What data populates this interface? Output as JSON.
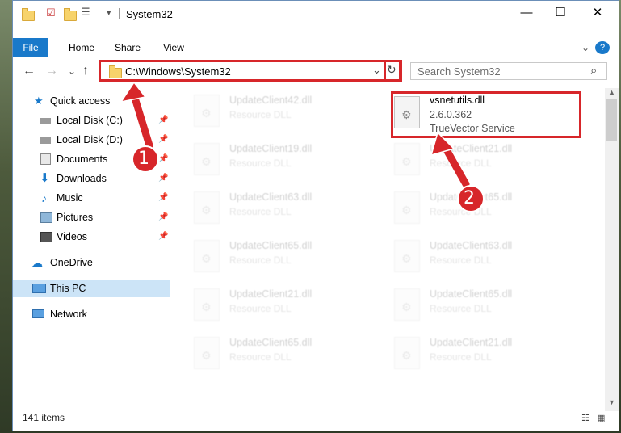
{
  "window": {
    "title": "System32",
    "minimize": "—",
    "maximize": "☐",
    "close": "✕"
  },
  "ribbon": {
    "tabs": [
      "File",
      "Home",
      "Share",
      "View"
    ],
    "expand_icon": "⌄",
    "help_icon": "?"
  },
  "navigation": {
    "back": "←",
    "forward": "→",
    "recent": "⌄",
    "up": "↑"
  },
  "address": {
    "path": "C:\\Windows\\System32",
    "dropdown": "⌄",
    "refresh": "↻"
  },
  "search": {
    "placeholder": "Search System32",
    "icon": "⌕"
  },
  "sidebar": {
    "items": [
      {
        "label": "Quick access",
        "icon": "star-icon"
      },
      {
        "label": "Local Disk (C:)",
        "icon": "drive-icon",
        "pinned": true
      },
      {
        "label": "Local Disk (D:)",
        "icon": "drive-icon",
        "pinned": true
      },
      {
        "label": "Documents",
        "icon": "documents-icon",
        "pinned": true
      },
      {
        "label": "Downloads",
        "icon": "download-icon",
        "pinned": true
      },
      {
        "label": "Music",
        "icon": "music-icon",
        "pinned": true
      },
      {
        "label": "Pictures",
        "icon": "pictures-icon",
        "pinned": true
      },
      {
        "label": "Videos",
        "icon": "videos-icon",
        "pinned": true
      },
      {
        "label": "OneDrive",
        "icon": "cloud-icon"
      },
      {
        "label": "This PC",
        "icon": "computer-icon",
        "selected": true
      },
      {
        "label": "Network",
        "icon": "network-icon"
      }
    ],
    "pin_glyph": "📌"
  },
  "files": {
    "highlighted": {
      "name": "vsnetutils.dll",
      "version": "2.6.0.362",
      "company": "TrueVector Service"
    },
    "faded": [
      {
        "name": "UpdateClient42.dll",
        "desc": "Resource DLL"
      },
      {
        "name": "UpdateClient19.dll",
        "desc": "Resource DLL"
      },
      {
        "name": "UpdateClient21.dll",
        "desc": "Resource DLL"
      },
      {
        "name": "UpdateClient63.dll",
        "desc": "Resource DLL"
      },
      {
        "name": "UpdateClient65.dll",
        "desc": "Resource DLL"
      },
      {
        "name": "UpdateClient65.dll",
        "desc": "Resource DLL"
      },
      {
        "name": "UpdateClient63.dll",
        "desc": "Resource DLL"
      },
      {
        "name": "UpdateClient21.dll",
        "desc": "Resource DLL"
      },
      {
        "name": "UpdateClient65.dll",
        "desc": "Resource DLL"
      },
      {
        "name": "UpdateClient65.dll",
        "desc": "Resource DLL"
      },
      {
        "name": "UpdateClient21.dll",
        "desc": "Resource DLL"
      }
    ]
  },
  "status": {
    "count": "141 items"
  },
  "annotations": {
    "step1": "1",
    "step2": "2",
    "color": "#d7262a"
  }
}
